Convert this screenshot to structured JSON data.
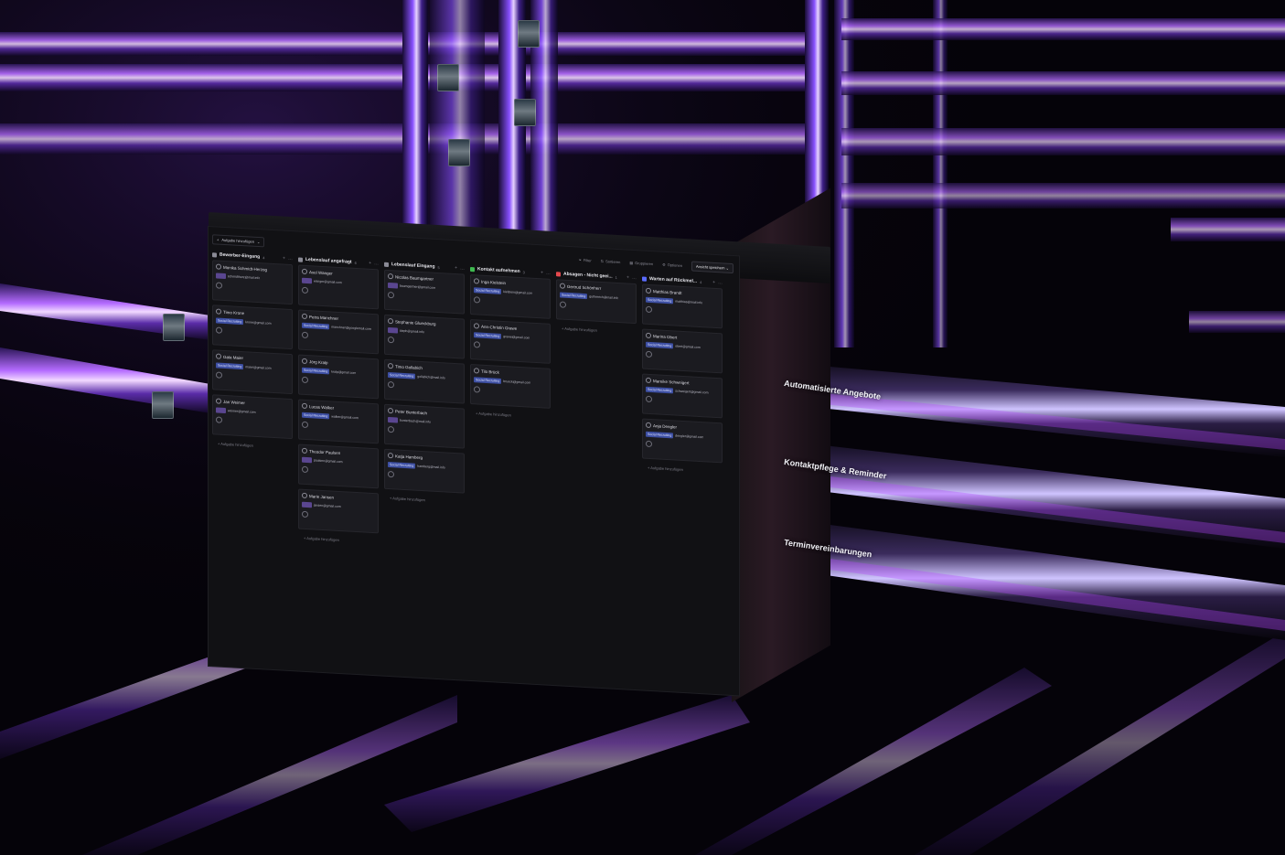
{
  "toolbar": {
    "add_task": "Aufgabe hinzufügen",
    "filter": "Filter",
    "sort": "Sortieren",
    "group": "Gruppieren",
    "options": "Optionen",
    "save_view": "Ansicht speichern"
  },
  "columns": [
    {
      "title": "Bewerber-Eingang",
      "count": "4",
      "status_color": "#8b8b96",
      "cards": [
        {
          "name": "Monika Schmidt-Herzog",
          "tag": "",
          "email": "schmidtherz@mail.info"
        },
        {
          "name": "Timo Krone",
          "tag": "Social Recruiting",
          "email": "krone@gmail.com"
        },
        {
          "name": "Gala Maier",
          "tag": "Social Recruiting",
          "email": "maier@gmail.com"
        },
        {
          "name": "Jan Weimer",
          "tag": "",
          "email": "weimer@gmail.com"
        }
      ],
      "add_label": "+ Aufgabe hinzufügen"
    },
    {
      "title": "Lebenslauf angefragt",
      "count": "6",
      "status_color": "#8b8b96",
      "cards": [
        {
          "name": "Axel Wanger",
          "tag": "",
          "email": "wanger@gmail.com"
        },
        {
          "name": "Petra Manchner",
          "tag": "Social Recruiting",
          "email": "manchner@googlemail.com"
        },
        {
          "name": "Jörg Kralp",
          "tag": "Social Recruiting",
          "email": "kralp@gmail.com"
        },
        {
          "name": "Lucas Walker",
          "tag": "Social Recruiting",
          "email": "walker@gmail.com"
        },
        {
          "name": "Theodor Paulsen",
          "tag": "",
          "email": "paulsen@gmail.com"
        },
        {
          "name": "Marie Jansen",
          "tag": "",
          "email": "jansen@gmail.com"
        }
      ],
      "add_label": "+ Aufgabe hinzufügen"
    },
    {
      "title": "Lebenslauf Eingang",
      "count": "5",
      "status_color": "#8b8b96",
      "cards": [
        {
          "name": "Nicolas Baumgartner",
          "tag": "",
          "email": "baumgartner@gmail.com"
        },
        {
          "name": "Stephanie Glueckburg",
          "tag": "",
          "email": "steph@gmail.info"
        },
        {
          "name": "Timo Gollabich",
          "tag": "Social Recruiting",
          "email": "gollabich@mail.info"
        },
        {
          "name": "Peter Bunterbach",
          "tag": "",
          "email": "bunterbach@mail.info"
        },
        {
          "name": "Katja Hamberg",
          "tag": "Social Recruiting",
          "email": "hamberg@mail.info"
        }
      ],
      "add_label": "+ Aufgabe hinzufügen"
    },
    {
      "title": "Kontakt aufnehmen",
      "count": "3",
      "status_color": "#3fb950",
      "cards": [
        {
          "name": "Inga Kielstein",
          "tag": "Social Recruiting",
          "email": "kielstein@gmail.com"
        },
        {
          "name": "Ann-Christin Grawe",
          "tag": "Social Recruiting",
          "email": "grawe@gmail.com"
        },
        {
          "name": "Tilo Brück",
          "tag": "Social Recruiting",
          "email": "brueck@gmail.com"
        }
      ],
      "add_label": "+ Aufgabe hinzufügen"
    },
    {
      "title": "Absagen - Nicht geei...",
      "count": "1",
      "status_color": "#e5484d",
      "cards": [
        {
          "name": "Gertrud Schönherr",
          "tag": "Social Recruiting",
          "email": "gutherrich@mail.info"
        }
      ],
      "add_label": "+ Aufgabe hinzufügen"
    },
    {
      "title": "Warten auf Rückmel...",
      "count": "4",
      "status_color": "#5b6cff",
      "cards": [
        {
          "name": "Matthias Brandt",
          "tag": "Social Recruiting",
          "email": "matthias@mail.info"
        },
        {
          "name": "Marina Obert",
          "tag": "Social Recruiting",
          "email": "obert@gmail.com"
        },
        {
          "name": "Mareike Schweigert",
          "tag": "Social Recruiting",
          "email": "schweigert@gmail.com"
        },
        {
          "name": "Anja Dengler",
          "tag": "Social Recruiting",
          "email": "dengler@gmail.com"
        }
      ],
      "add_label": "+ Aufgabe hinzufügen"
    }
  ],
  "pipes": [
    "Automatisierte Angebote",
    "Kontaktpflege & Reminder",
    "Terminvereinbarungen"
  ],
  "colors": {
    "accent_purple": "#a14cff",
    "accent_blue": "#4b5bff",
    "tag_blue": "#3d4fa3"
  }
}
